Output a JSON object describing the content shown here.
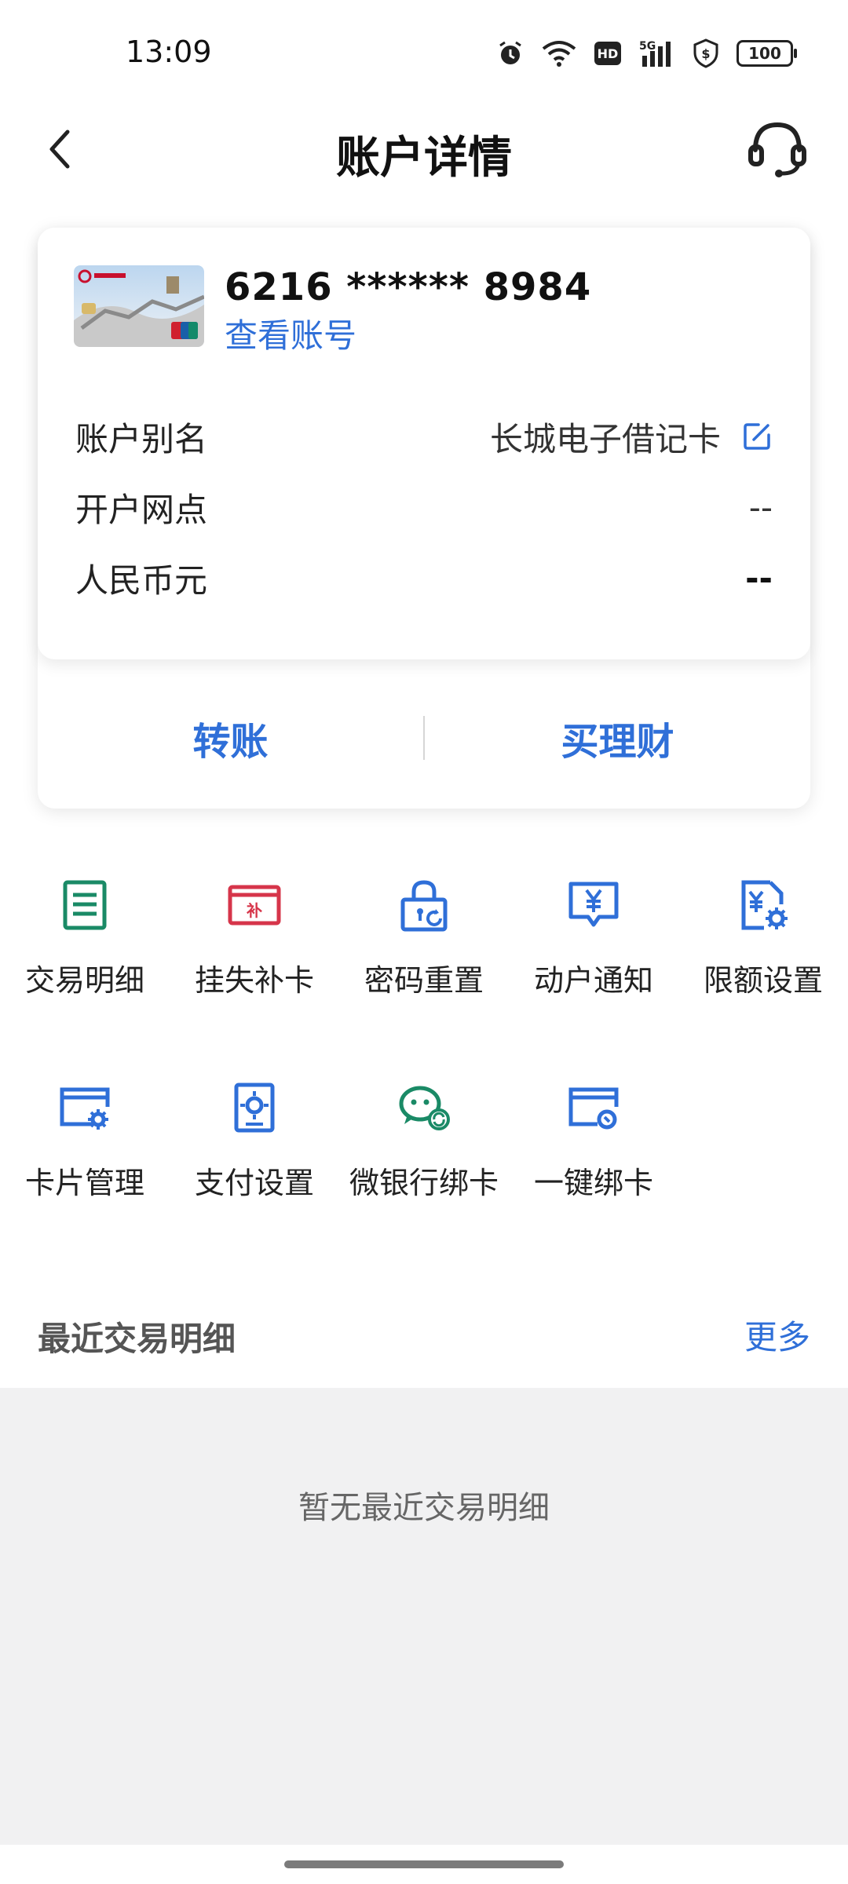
{
  "status_bar": {
    "time": "13:09",
    "battery": "100"
  },
  "header": {
    "title": "账户详情"
  },
  "card": {
    "number": "6216 ****** 8984",
    "view_account_label": "查看账号",
    "rows": [
      {
        "label": "账户别名",
        "value": "长城电子借记卡"
      },
      {
        "label": "开户网点",
        "value": "--"
      },
      {
        "label": "人民币元",
        "value": "--"
      }
    ],
    "actions": [
      {
        "label": "转账"
      },
      {
        "label": "买理财"
      }
    ]
  },
  "functions": [
    {
      "label": "交易明细",
      "icon": "list-doc-icon",
      "color": "#1a8a66"
    },
    {
      "label": "挂失补卡",
      "icon": "card-repair-icon",
      "color": "#d6354a"
    },
    {
      "label": "密码重置",
      "icon": "lock-reset-icon",
      "color": "#2f6fd8"
    },
    {
      "label": "动户通知",
      "icon": "yuan-notice-icon",
      "color": "#2f6fd8"
    },
    {
      "label": "限额设置",
      "icon": "yuan-settings-icon",
      "color": "#2f6fd8"
    },
    {
      "label": "卡片管理",
      "icon": "card-settings-icon",
      "color": "#2f6fd8"
    },
    {
      "label": "支付设置",
      "icon": "payment-settings-icon",
      "color": "#2f6fd8"
    },
    {
      "label": "微银行绑卡",
      "icon": "wechat-bind-icon",
      "color": "#1a8a66"
    },
    {
      "label": "一键绑卡",
      "icon": "card-link-icon",
      "color": "#2f6fd8"
    }
  ],
  "recent": {
    "title": "最近交易明细",
    "more_label": "更多",
    "empty_text": "暂无最近交易明细"
  }
}
